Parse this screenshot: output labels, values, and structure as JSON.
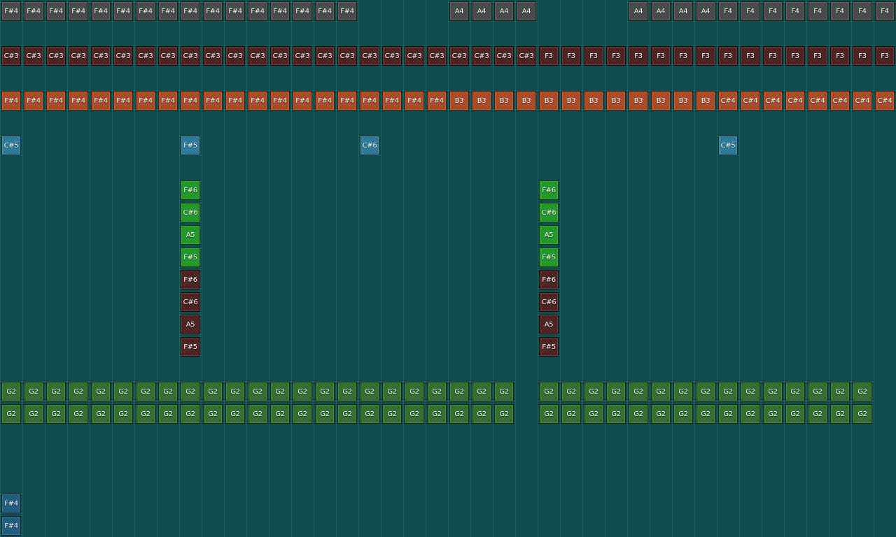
{
  "colors": {
    "background": "#124b4c",
    "gray": "#474747",
    "maroon": "#4a1f1c",
    "orange": "#ad4a26",
    "blue": "#2a7a9e",
    "green": "#1e9a26",
    "olive": "#2e6e2e",
    "navy": "#1c5a82"
  },
  "rows": [
    {
      "row": 0,
      "color": "gray",
      "notes": [
        {
          "col": 0,
          "label": "F#4"
        },
        {
          "col": 1,
          "label": "F#4"
        },
        {
          "col": 2,
          "label": "F#4"
        },
        {
          "col": 3,
          "label": "F#4"
        },
        {
          "col": 4,
          "label": "F#4"
        },
        {
          "col": 5,
          "label": "F#4"
        },
        {
          "col": 6,
          "label": "F#4"
        },
        {
          "col": 7,
          "label": "F#4"
        },
        {
          "col": 8,
          "label": "F#4"
        },
        {
          "col": 9,
          "label": "F#4"
        },
        {
          "col": 10,
          "label": "F#4"
        },
        {
          "col": 11,
          "label": "F#4"
        },
        {
          "col": 12,
          "label": "F#4"
        },
        {
          "col": 13,
          "label": "F#4"
        },
        {
          "col": 14,
          "label": "F#4"
        },
        {
          "col": 15,
          "label": "F#4"
        },
        {
          "col": 20,
          "label": "A4"
        },
        {
          "col": 21,
          "label": "A4"
        },
        {
          "col": 22,
          "label": "A4"
        },
        {
          "col": 23,
          "label": "A4"
        },
        {
          "col": 28,
          "label": "A4"
        },
        {
          "col": 29,
          "label": "A4"
        },
        {
          "col": 30,
          "label": "A4"
        },
        {
          "col": 31,
          "label": "A4"
        },
        {
          "col": 32,
          "label": "F4"
        },
        {
          "col": 33,
          "label": "F4"
        },
        {
          "col": 34,
          "label": "F4"
        },
        {
          "col": 35,
          "label": "F4"
        },
        {
          "col": 36,
          "label": "F4"
        },
        {
          "col": 37,
          "label": "F4"
        },
        {
          "col": 38,
          "label": "F4"
        },
        {
          "col": 39,
          "label": "F4"
        }
      ]
    },
    {
      "row": 2,
      "color": "maroon",
      "notes": [
        {
          "col": 0,
          "label": "C#3"
        },
        {
          "col": 1,
          "label": "C#3"
        },
        {
          "col": 2,
          "label": "C#3"
        },
        {
          "col": 3,
          "label": "C#3"
        },
        {
          "col": 4,
          "label": "C#3"
        },
        {
          "col": 5,
          "label": "C#3"
        },
        {
          "col": 6,
          "label": "C#3"
        },
        {
          "col": 7,
          "label": "C#3"
        },
        {
          "col": 8,
          "label": "C#3"
        },
        {
          "col": 9,
          "label": "C#3"
        },
        {
          "col": 10,
          "label": "C#3"
        },
        {
          "col": 11,
          "label": "C#3"
        },
        {
          "col": 12,
          "label": "C#3"
        },
        {
          "col": 13,
          "label": "C#3"
        },
        {
          "col": 14,
          "label": "C#3"
        },
        {
          "col": 15,
          "label": "C#3"
        },
        {
          "col": 16,
          "label": "C#3"
        },
        {
          "col": 17,
          "label": "C#3"
        },
        {
          "col": 18,
          "label": "C#3"
        },
        {
          "col": 19,
          "label": "C#3"
        },
        {
          "col": 20,
          "label": "C#3"
        },
        {
          "col": 21,
          "label": "C#3"
        },
        {
          "col": 22,
          "label": "C#3"
        },
        {
          "col": 23,
          "label": "C#3"
        },
        {
          "col": 24,
          "label": "F3"
        },
        {
          "col": 25,
          "label": "F3"
        },
        {
          "col": 26,
          "label": "F3"
        },
        {
          "col": 27,
          "label": "F3"
        },
        {
          "col": 28,
          "label": "F3"
        },
        {
          "col": 29,
          "label": "F3"
        },
        {
          "col": 30,
          "label": "F3"
        },
        {
          "col": 31,
          "label": "F3"
        },
        {
          "col": 32,
          "label": "F3"
        },
        {
          "col": 33,
          "label": "F3"
        },
        {
          "col": 34,
          "label": "F3"
        },
        {
          "col": 35,
          "label": "F3"
        },
        {
          "col": 36,
          "label": "F3"
        },
        {
          "col": 37,
          "label": "F3"
        },
        {
          "col": 38,
          "label": "F3"
        },
        {
          "col": 39,
          "label": "F3"
        }
      ]
    },
    {
      "row": 4,
      "color": "orange",
      "notes": [
        {
          "col": 0,
          "label": "F#4"
        },
        {
          "col": 1,
          "label": "F#4"
        },
        {
          "col": 2,
          "label": "F#4"
        },
        {
          "col": 3,
          "label": "F#4"
        },
        {
          "col": 4,
          "label": "F#4"
        },
        {
          "col": 5,
          "label": "F#4"
        },
        {
          "col": 6,
          "label": "F#4"
        },
        {
          "col": 7,
          "label": "F#4"
        },
        {
          "col": 8,
          "label": "F#4"
        },
        {
          "col": 9,
          "label": "F#4"
        },
        {
          "col": 10,
          "label": "F#4"
        },
        {
          "col": 11,
          "label": "F#4"
        },
        {
          "col": 12,
          "label": "F#4"
        },
        {
          "col": 13,
          "label": "F#4"
        },
        {
          "col": 14,
          "label": "F#4"
        },
        {
          "col": 15,
          "label": "F#4"
        },
        {
          "col": 16,
          "label": "F#4"
        },
        {
          "col": 17,
          "label": "F#4"
        },
        {
          "col": 18,
          "label": "F#4"
        },
        {
          "col": 19,
          "label": "F#4"
        },
        {
          "col": 20,
          "label": "B3"
        },
        {
          "col": 21,
          "label": "B3"
        },
        {
          "col": 22,
          "label": "B3"
        },
        {
          "col": 23,
          "label": "B3"
        },
        {
          "col": 24,
          "label": "B3"
        },
        {
          "col": 25,
          "label": "B3"
        },
        {
          "col": 26,
          "label": "B3"
        },
        {
          "col": 27,
          "label": "B3"
        },
        {
          "col": 28,
          "label": "B3"
        },
        {
          "col": 29,
          "label": "B3"
        },
        {
          "col": 30,
          "label": "B3"
        },
        {
          "col": 31,
          "label": "B3"
        },
        {
          "col": 32,
          "label": "C#4"
        },
        {
          "col": 33,
          "label": "C#4"
        },
        {
          "col": 34,
          "label": "C#4"
        },
        {
          "col": 35,
          "label": "C#4"
        },
        {
          "col": 36,
          "label": "C#4"
        },
        {
          "col": 37,
          "label": "C#4"
        },
        {
          "col": 38,
          "label": "C#4"
        },
        {
          "col": 39,
          "label": "C#4"
        }
      ]
    },
    {
      "row": 6,
      "color": "blue",
      "notes": [
        {
          "col": 0,
          "label": "C#5"
        },
        {
          "col": 8,
          "label": "F#5"
        },
        {
          "col": 16,
          "label": "C#6"
        },
        {
          "col": 32,
          "label": "C#5"
        }
      ]
    },
    {
      "row": 8,
      "color": "green",
      "notes": [
        {
          "col": 8,
          "label": "F#6"
        },
        {
          "col": 24,
          "label": "F#6"
        }
      ]
    },
    {
      "row": 9,
      "color": "green",
      "notes": [
        {
          "col": 8,
          "label": "C#6"
        },
        {
          "col": 24,
          "label": "C#6"
        }
      ]
    },
    {
      "row": 10,
      "color": "green",
      "notes": [
        {
          "col": 8,
          "label": "A5"
        },
        {
          "col": 24,
          "label": "A5"
        }
      ]
    },
    {
      "row": 11,
      "color": "green",
      "notes": [
        {
          "col": 8,
          "label": "F#5"
        },
        {
          "col": 24,
          "label": "F#5"
        }
      ]
    },
    {
      "row": 12,
      "color": "maroon",
      "notes": [
        {
          "col": 8,
          "label": "F#6"
        },
        {
          "col": 24,
          "label": "F#6"
        }
      ]
    },
    {
      "row": 13,
      "color": "maroon",
      "notes": [
        {
          "col": 8,
          "label": "C#6"
        },
        {
          "col": 24,
          "label": "C#6"
        }
      ]
    },
    {
      "row": 14,
      "color": "maroon",
      "notes": [
        {
          "col": 8,
          "label": "A5"
        },
        {
          "col": 24,
          "label": "A5"
        }
      ]
    },
    {
      "row": 15,
      "color": "maroon",
      "notes": [
        {
          "col": 8,
          "label": "F#5"
        },
        {
          "col": 24,
          "label": "F#5"
        }
      ]
    },
    {
      "row": 17,
      "color": "olive",
      "notes": [
        {
          "col": 0,
          "label": "G2"
        },
        {
          "col": 1,
          "label": "G2"
        },
        {
          "col": 2,
          "label": "G2"
        },
        {
          "col": 3,
          "label": "G2"
        },
        {
          "col": 4,
          "label": "G2"
        },
        {
          "col": 5,
          "label": "G2"
        },
        {
          "col": 6,
          "label": "G2"
        },
        {
          "col": 7,
          "label": "G2"
        },
        {
          "col": 8,
          "label": "G2"
        },
        {
          "col": 9,
          "label": "G2"
        },
        {
          "col": 10,
          "label": "G2"
        },
        {
          "col": 11,
          "label": "G2"
        },
        {
          "col": 12,
          "label": "G2"
        },
        {
          "col": 13,
          "label": "G2"
        },
        {
          "col": 14,
          "label": "G2"
        },
        {
          "col": 15,
          "label": "G2"
        },
        {
          "col": 16,
          "label": "G2"
        },
        {
          "col": 17,
          "label": "G2"
        },
        {
          "col": 18,
          "label": "G2"
        },
        {
          "col": 19,
          "label": "G2"
        },
        {
          "col": 20,
          "label": "G2"
        },
        {
          "col": 21,
          "label": "G2"
        },
        {
          "col": 22,
          "label": "G2"
        },
        {
          "col": 24,
          "label": "G2"
        },
        {
          "col": 25,
          "label": "G2"
        },
        {
          "col": 26,
          "label": "G2"
        },
        {
          "col": 27,
          "label": "G2"
        },
        {
          "col": 28,
          "label": "G2"
        },
        {
          "col": 29,
          "label": "G2"
        },
        {
          "col": 30,
          "label": "G2"
        },
        {
          "col": 31,
          "label": "G2"
        },
        {
          "col": 32,
          "label": "G2"
        },
        {
          "col": 33,
          "label": "G2"
        },
        {
          "col": 34,
          "label": "G2"
        },
        {
          "col": 35,
          "label": "G2"
        },
        {
          "col": 36,
          "label": "G2"
        },
        {
          "col": 37,
          "label": "G2"
        },
        {
          "col": 38,
          "label": "G2"
        }
      ]
    },
    {
      "row": 18,
      "color": "olive",
      "notes": [
        {
          "col": 0,
          "label": "G2"
        },
        {
          "col": 1,
          "label": "G2"
        },
        {
          "col": 2,
          "label": "G2"
        },
        {
          "col": 3,
          "label": "G2"
        },
        {
          "col": 4,
          "label": "G2"
        },
        {
          "col": 5,
          "label": "G2"
        },
        {
          "col": 6,
          "label": "G2"
        },
        {
          "col": 7,
          "label": "G2"
        },
        {
          "col": 8,
          "label": "G2"
        },
        {
          "col": 9,
          "label": "G2"
        },
        {
          "col": 10,
          "label": "G2"
        },
        {
          "col": 11,
          "label": "G2"
        },
        {
          "col": 12,
          "label": "G2"
        },
        {
          "col": 13,
          "label": "G2"
        },
        {
          "col": 14,
          "label": "G2"
        },
        {
          "col": 15,
          "label": "G2"
        },
        {
          "col": 16,
          "label": "G2"
        },
        {
          "col": 17,
          "label": "G2"
        },
        {
          "col": 18,
          "label": "G2"
        },
        {
          "col": 19,
          "label": "G2"
        },
        {
          "col": 20,
          "label": "G2"
        },
        {
          "col": 21,
          "label": "G2"
        },
        {
          "col": 22,
          "label": "G2"
        },
        {
          "col": 24,
          "label": "G2"
        },
        {
          "col": 25,
          "label": "G2"
        },
        {
          "col": 26,
          "label": "G2"
        },
        {
          "col": 27,
          "label": "G2"
        },
        {
          "col": 28,
          "label": "G2"
        },
        {
          "col": 29,
          "label": "G2"
        },
        {
          "col": 30,
          "label": "G2"
        },
        {
          "col": 31,
          "label": "G2"
        },
        {
          "col": 32,
          "label": "G2"
        },
        {
          "col": 33,
          "label": "G2"
        },
        {
          "col": 34,
          "label": "G2"
        },
        {
          "col": 35,
          "label": "G2"
        },
        {
          "col": 36,
          "label": "G2"
        },
        {
          "col": 37,
          "label": "G2"
        },
        {
          "col": 38,
          "label": "G2"
        }
      ]
    },
    {
      "row": 22,
      "color": "navy",
      "notes": [
        {
          "col": 0,
          "label": "F#4"
        }
      ]
    },
    {
      "row": 23,
      "color": "navy",
      "notes": [
        {
          "col": 0,
          "label": "F#4"
        }
      ]
    }
  ]
}
